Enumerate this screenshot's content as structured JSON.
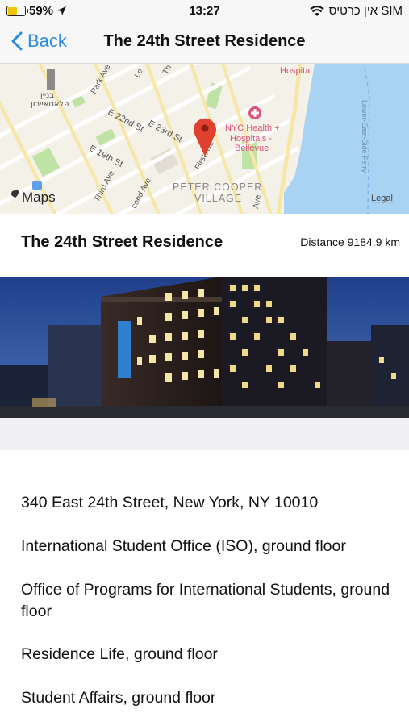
{
  "status_bar": {
    "battery": "59%",
    "battery_level": 0.59,
    "time": "13:27",
    "carrier": "אין כרטיס SIM"
  },
  "nav": {
    "back_label": "Back",
    "title": "The 24th Street Residence"
  },
  "map": {
    "labels": {
      "hospital": "Hospital",
      "park_ave": "Park Ave",
      "lex": "Le",
      "third_top": "Th",
      "building_1": "בניין",
      "building_2": "פלאטאיירון",
      "e22": "E 22nd St",
      "e23": "E 23rd St",
      "e19": "E 19th St",
      "third_ave": "Third Ave",
      "second_ave": "cond Ave",
      "first_ave": "First Ave",
      "nyc_health_1": "NYC Health +",
      "nyc_health_2": "Hospitals -",
      "nyc_health_3": "Bellevue",
      "peter_cooper_1": "PETER COOPER",
      "peter_cooper_2": "VILLAGE",
      "ave": "Ave",
      "ferry": "Lower-East-Side Ferry",
      "maps_brand": "Maps",
      "legal": "Legal"
    }
  },
  "info": {
    "title": "The 24th Street Residence",
    "distance": "Distance 9184.9 km"
  },
  "details": [
    "340 East 24th Street, New York, NY 10010",
    "International Student Office (ISO), ground floor",
    "Office of Programs for International Students, ground floor",
    "Residence Life, ground floor",
    "Student Affairs, ground floor"
  ]
}
